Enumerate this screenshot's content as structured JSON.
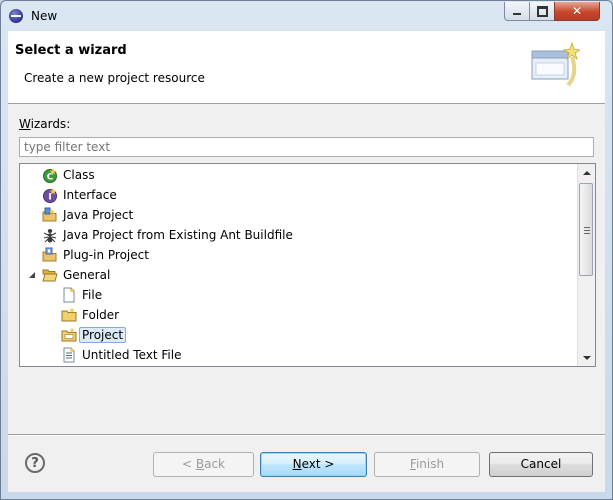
{
  "window": {
    "title": "New"
  },
  "banner": {
    "title": "Select a wizard",
    "description": "Create a new project resource"
  },
  "wizards": {
    "label_mnemonic": "W",
    "label_rest": "izards:",
    "filter_placeholder": "type filter text"
  },
  "tree": {
    "items": [
      {
        "label": "Class",
        "icon": "java-class-icon"
      },
      {
        "label": "Interface",
        "icon": "java-interface-icon"
      },
      {
        "label": "Java Project",
        "icon": "java-project-icon"
      },
      {
        "label": "Java Project from Existing Ant Buildfile",
        "icon": "ant-icon"
      },
      {
        "label": "Plug-in Project",
        "icon": "plugin-project-icon"
      },
      {
        "label": "General",
        "icon": "open-folder-icon",
        "expanded": true
      },
      {
        "label": "File",
        "icon": "file-icon"
      },
      {
        "label": "Folder",
        "icon": "folder-icon"
      },
      {
        "label": "Project",
        "icon": "project-icon",
        "selected": true
      },
      {
        "label": "Untitled Text File",
        "icon": "text-file-icon"
      }
    ]
  },
  "buttons": {
    "back_pre": "< ",
    "back_mn": "B",
    "back_post": "ack",
    "next_mn": "N",
    "next_post": "ext >",
    "finish_mn": "F",
    "finish_post": "inish",
    "cancel": "Cancel"
  },
  "colors": {
    "selection_bg": "#dceafc",
    "selection_border": "#84acdd",
    "close_button": "#c7472f"
  }
}
